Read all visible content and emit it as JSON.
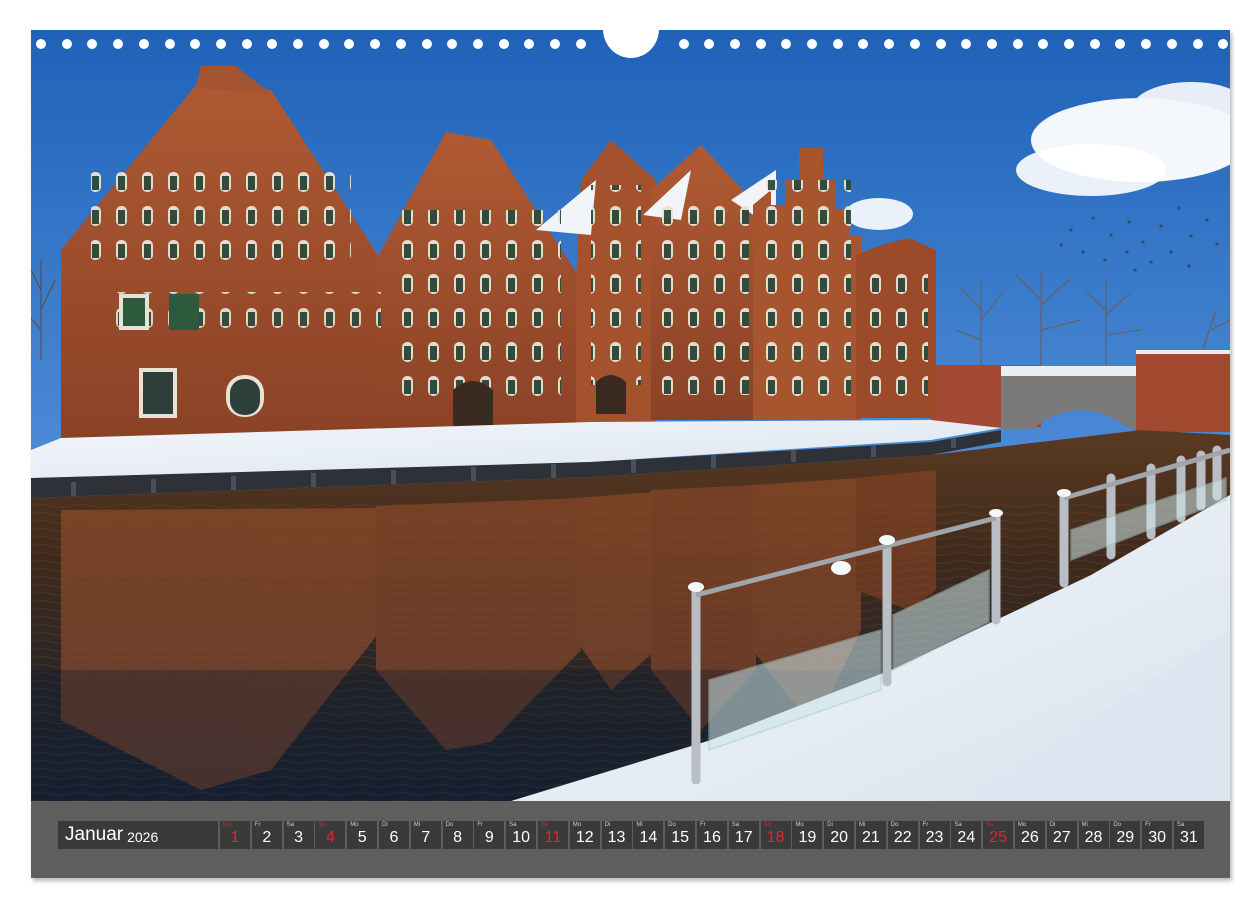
{
  "calendar": {
    "month": "Januar",
    "year": "2026",
    "days": [
      {
        "dow": "Do",
        "num": "1",
        "holiday": true
      },
      {
        "dow": "Fr",
        "num": "2"
      },
      {
        "dow": "Sa",
        "num": "3"
      },
      {
        "dow": "So",
        "num": "4",
        "holiday": true
      },
      {
        "dow": "Mo",
        "num": "5"
      },
      {
        "dow": "Di",
        "num": "6"
      },
      {
        "dow": "Mi",
        "num": "7"
      },
      {
        "dow": "Do",
        "num": "8"
      },
      {
        "dow": "Fr",
        "num": "9"
      },
      {
        "dow": "Sa",
        "num": "10"
      },
      {
        "dow": "So",
        "num": "11",
        "holiday": true
      },
      {
        "dow": "Mo",
        "num": "12"
      },
      {
        "dow": "Di",
        "num": "13"
      },
      {
        "dow": "Mi",
        "num": "14"
      },
      {
        "dow": "Do",
        "num": "15"
      },
      {
        "dow": "Fr",
        "num": "16"
      },
      {
        "dow": "Sa",
        "num": "17"
      },
      {
        "dow": "So",
        "num": "18",
        "holiday": true
      },
      {
        "dow": "Mo",
        "num": "19"
      },
      {
        "dow": "Di",
        "num": "20"
      },
      {
        "dow": "Mi",
        "num": "21"
      },
      {
        "dow": "Do",
        "num": "22"
      },
      {
        "dow": "Fr",
        "num": "23"
      },
      {
        "dow": "Sa",
        "num": "24"
      },
      {
        "dow": "So",
        "num": "25",
        "holiday": true
      },
      {
        "dow": "Mo",
        "num": "26"
      },
      {
        "dow": "Di",
        "num": "27"
      },
      {
        "dow": "Mi",
        "num": "28"
      },
      {
        "dow": "Do",
        "num": "29"
      },
      {
        "dow": "Fr",
        "num": "30"
      },
      {
        "dow": "Sa",
        "num": "31"
      }
    ]
  },
  "colors": {
    "bar": "#5e5e5e",
    "cell": "#3a3a3a",
    "holiday": "#e8212a",
    "sky_top": "#1f62b8",
    "brick": "#9a4a2a",
    "water": "#1e2a3c"
  },
  "photo": {
    "subject": "historic brick salt storehouses beside a river in winter snow"
  }
}
